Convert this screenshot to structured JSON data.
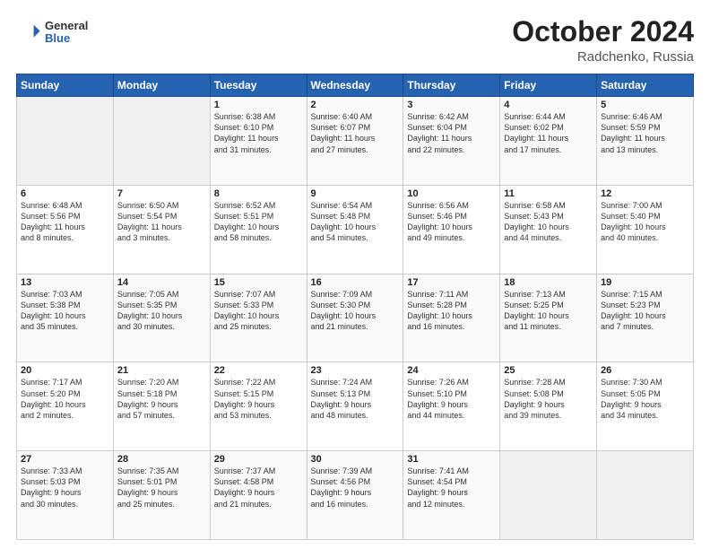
{
  "header": {
    "logo_general": "General",
    "logo_blue": "Blue",
    "month_title": "October 2024",
    "location": "Radchenko, Russia"
  },
  "days_of_week": [
    "Sunday",
    "Monday",
    "Tuesday",
    "Wednesday",
    "Thursday",
    "Friday",
    "Saturday"
  ],
  "weeks": [
    [
      {
        "day": "",
        "info": ""
      },
      {
        "day": "",
        "info": ""
      },
      {
        "day": "1",
        "info": "Sunrise: 6:38 AM\nSunset: 6:10 PM\nDaylight: 11 hours\nand 31 minutes."
      },
      {
        "day": "2",
        "info": "Sunrise: 6:40 AM\nSunset: 6:07 PM\nDaylight: 11 hours\nand 27 minutes."
      },
      {
        "day": "3",
        "info": "Sunrise: 6:42 AM\nSunset: 6:04 PM\nDaylight: 11 hours\nand 22 minutes."
      },
      {
        "day": "4",
        "info": "Sunrise: 6:44 AM\nSunset: 6:02 PM\nDaylight: 11 hours\nand 17 minutes."
      },
      {
        "day": "5",
        "info": "Sunrise: 6:46 AM\nSunset: 5:59 PM\nDaylight: 11 hours\nand 13 minutes."
      }
    ],
    [
      {
        "day": "6",
        "info": "Sunrise: 6:48 AM\nSunset: 5:56 PM\nDaylight: 11 hours\nand 8 minutes."
      },
      {
        "day": "7",
        "info": "Sunrise: 6:50 AM\nSunset: 5:54 PM\nDaylight: 11 hours\nand 3 minutes."
      },
      {
        "day": "8",
        "info": "Sunrise: 6:52 AM\nSunset: 5:51 PM\nDaylight: 10 hours\nand 58 minutes."
      },
      {
        "day": "9",
        "info": "Sunrise: 6:54 AM\nSunset: 5:48 PM\nDaylight: 10 hours\nand 54 minutes."
      },
      {
        "day": "10",
        "info": "Sunrise: 6:56 AM\nSunset: 5:46 PM\nDaylight: 10 hours\nand 49 minutes."
      },
      {
        "day": "11",
        "info": "Sunrise: 6:58 AM\nSunset: 5:43 PM\nDaylight: 10 hours\nand 44 minutes."
      },
      {
        "day": "12",
        "info": "Sunrise: 7:00 AM\nSunset: 5:40 PM\nDaylight: 10 hours\nand 40 minutes."
      }
    ],
    [
      {
        "day": "13",
        "info": "Sunrise: 7:03 AM\nSunset: 5:38 PM\nDaylight: 10 hours\nand 35 minutes."
      },
      {
        "day": "14",
        "info": "Sunrise: 7:05 AM\nSunset: 5:35 PM\nDaylight: 10 hours\nand 30 minutes."
      },
      {
        "day": "15",
        "info": "Sunrise: 7:07 AM\nSunset: 5:33 PM\nDaylight: 10 hours\nand 25 minutes."
      },
      {
        "day": "16",
        "info": "Sunrise: 7:09 AM\nSunset: 5:30 PM\nDaylight: 10 hours\nand 21 minutes."
      },
      {
        "day": "17",
        "info": "Sunrise: 7:11 AM\nSunset: 5:28 PM\nDaylight: 10 hours\nand 16 minutes."
      },
      {
        "day": "18",
        "info": "Sunrise: 7:13 AM\nSunset: 5:25 PM\nDaylight: 10 hours\nand 11 minutes."
      },
      {
        "day": "19",
        "info": "Sunrise: 7:15 AM\nSunset: 5:23 PM\nDaylight: 10 hours\nand 7 minutes."
      }
    ],
    [
      {
        "day": "20",
        "info": "Sunrise: 7:17 AM\nSunset: 5:20 PM\nDaylight: 10 hours\nand 2 minutes."
      },
      {
        "day": "21",
        "info": "Sunrise: 7:20 AM\nSunset: 5:18 PM\nDaylight: 9 hours\nand 57 minutes."
      },
      {
        "day": "22",
        "info": "Sunrise: 7:22 AM\nSunset: 5:15 PM\nDaylight: 9 hours\nand 53 minutes."
      },
      {
        "day": "23",
        "info": "Sunrise: 7:24 AM\nSunset: 5:13 PM\nDaylight: 9 hours\nand 48 minutes."
      },
      {
        "day": "24",
        "info": "Sunrise: 7:26 AM\nSunset: 5:10 PM\nDaylight: 9 hours\nand 44 minutes."
      },
      {
        "day": "25",
        "info": "Sunrise: 7:28 AM\nSunset: 5:08 PM\nDaylight: 9 hours\nand 39 minutes."
      },
      {
        "day": "26",
        "info": "Sunrise: 7:30 AM\nSunset: 5:05 PM\nDaylight: 9 hours\nand 34 minutes."
      }
    ],
    [
      {
        "day": "27",
        "info": "Sunrise: 7:33 AM\nSunset: 5:03 PM\nDaylight: 9 hours\nand 30 minutes."
      },
      {
        "day": "28",
        "info": "Sunrise: 7:35 AM\nSunset: 5:01 PM\nDaylight: 9 hours\nand 25 minutes."
      },
      {
        "day": "29",
        "info": "Sunrise: 7:37 AM\nSunset: 4:58 PM\nDaylight: 9 hours\nand 21 minutes."
      },
      {
        "day": "30",
        "info": "Sunrise: 7:39 AM\nSunset: 4:56 PM\nDaylight: 9 hours\nand 16 minutes."
      },
      {
        "day": "31",
        "info": "Sunrise: 7:41 AM\nSunset: 4:54 PM\nDaylight: 9 hours\nand 12 minutes."
      },
      {
        "day": "",
        "info": ""
      },
      {
        "day": "",
        "info": ""
      }
    ]
  ]
}
